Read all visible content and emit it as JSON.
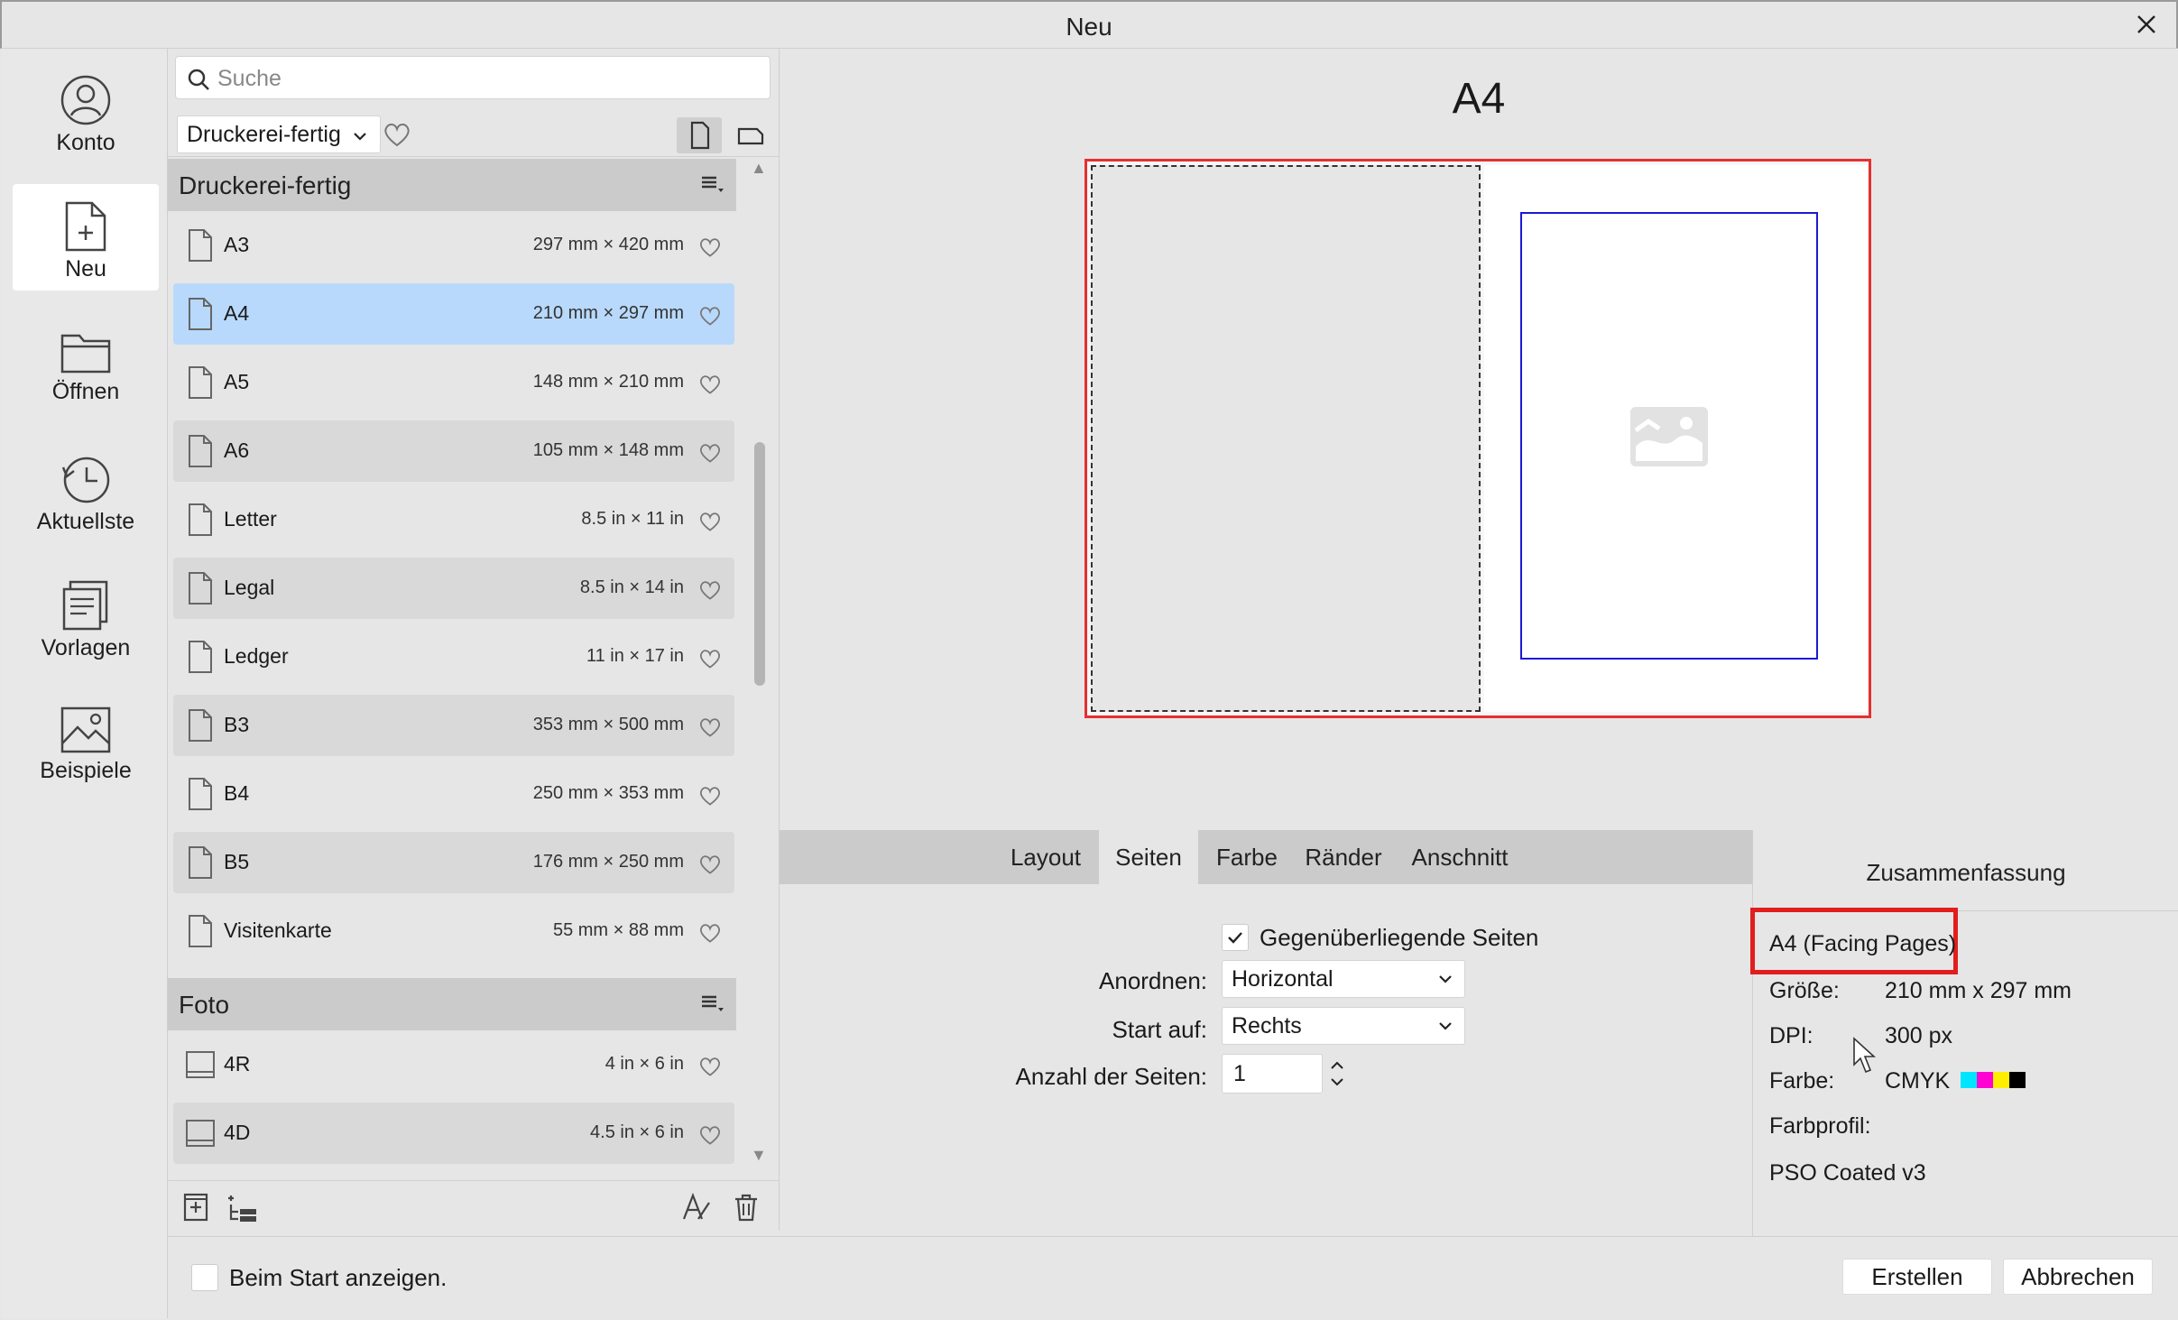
{
  "window": {
    "title": "Neu"
  },
  "rail": {
    "items": [
      {
        "label": "Konto",
        "icon": "account-icon"
      },
      {
        "label": "Neu",
        "icon": "new-document-icon",
        "active": true
      },
      {
        "label": "Öffnen",
        "icon": "folder-icon"
      },
      {
        "label": "Aktuellste",
        "icon": "history-icon"
      },
      {
        "label": "Vorlagen",
        "icon": "templates-icon"
      },
      {
        "label": "Beispiele",
        "icon": "image-icon"
      }
    ]
  },
  "presets": {
    "search_placeholder": "Suche",
    "filter_value": "Druckerei-fertig",
    "groups": [
      {
        "name": "Druckerei-fertig",
        "items": [
          {
            "name": "A3",
            "size": "297 mm × 420 mm"
          },
          {
            "name": "A4",
            "size": "210 mm × 297 mm",
            "selected": true
          },
          {
            "name": "A5",
            "size": "148 mm × 210 mm"
          },
          {
            "name": "A6",
            "size": "105 mm × 148 mm"
          },
          {
            "name": "Letter",
            "size": "8.5 in × 11 in"
          },
          {
            "name": "Legal",
            "size": "8.5 in × 14 in"
          },
          {
            "name": "Ledger",
            "size": "11 in × 17 in"
          },
          {
            "name": "B3",
            "size": "353 mm × 500 mm"
          },
          {
            "name": "B4",
            "size": "250 mm × 353 mm"
          },
          {
            "name": "B5",
            "size": "176 mm × 250 mm"
          },
          {
            "name": "Visitenkarte",
            "size": "55 mm × 88 mm"
          }
        ]
      },
      {
        "name": "Foto",
        "items": [
          {
            "name": "4R",
            "size": "4 in × 6 in"
          },
          {
            "name": "4D",
            "size": "4.5 in × 6 in"
          }
        ]
      }
    ]
  },
  "preview": {
    "title": "A4"
  },
  "tabs": [
    "Layout",
    "Seiten",
    "Farbe",
    "Ränder",
    "Anschnitt"
  ],
  "active_tab": "Seiten",
  "settings": {
    "facing_pages_label": "Gegenüberliegende Seiten",
    "facing_pages_checked": true,
    "arrange_label": "Anordnen:",
    "arrange_value": "Horizontal",
    "start_label": "Start auf:",
    "start_value": "Rechts",
    "count_label": "Anzahl der Seiten:",
    "count_value": "1"
  },
  "summary": {
    "heading": "Zusammenfassung",
    "name": "A4 (Facing Pages)",
    "size_label": "Größe:",
    "size_value": "210 mm  x  297 mm",
    "dpi_label": "DPI:",
    "dpi_value": "300 px",
    "color_label": "Farbe:",
    "color_value": "CMYK",
    "profile_label": "Farbprofil:",
    "profile_value": "PSO Coated v3",
    "swatches": [
      "#00e5ff",
      "#ff00d4",
      "#ffee00",
      "#000000"
    ]
  },
  "footer": {
    "show_on_start": "Beim Start anzeigen.",
    "create": "Erstellen",
    "cancel": "Abbrechen"
  },
  "colors": {
    "selection": "#b8d9fb",
    "highlight": "#e21d1d",
    "margin_guide": "#1a1ad6"
  }
}
